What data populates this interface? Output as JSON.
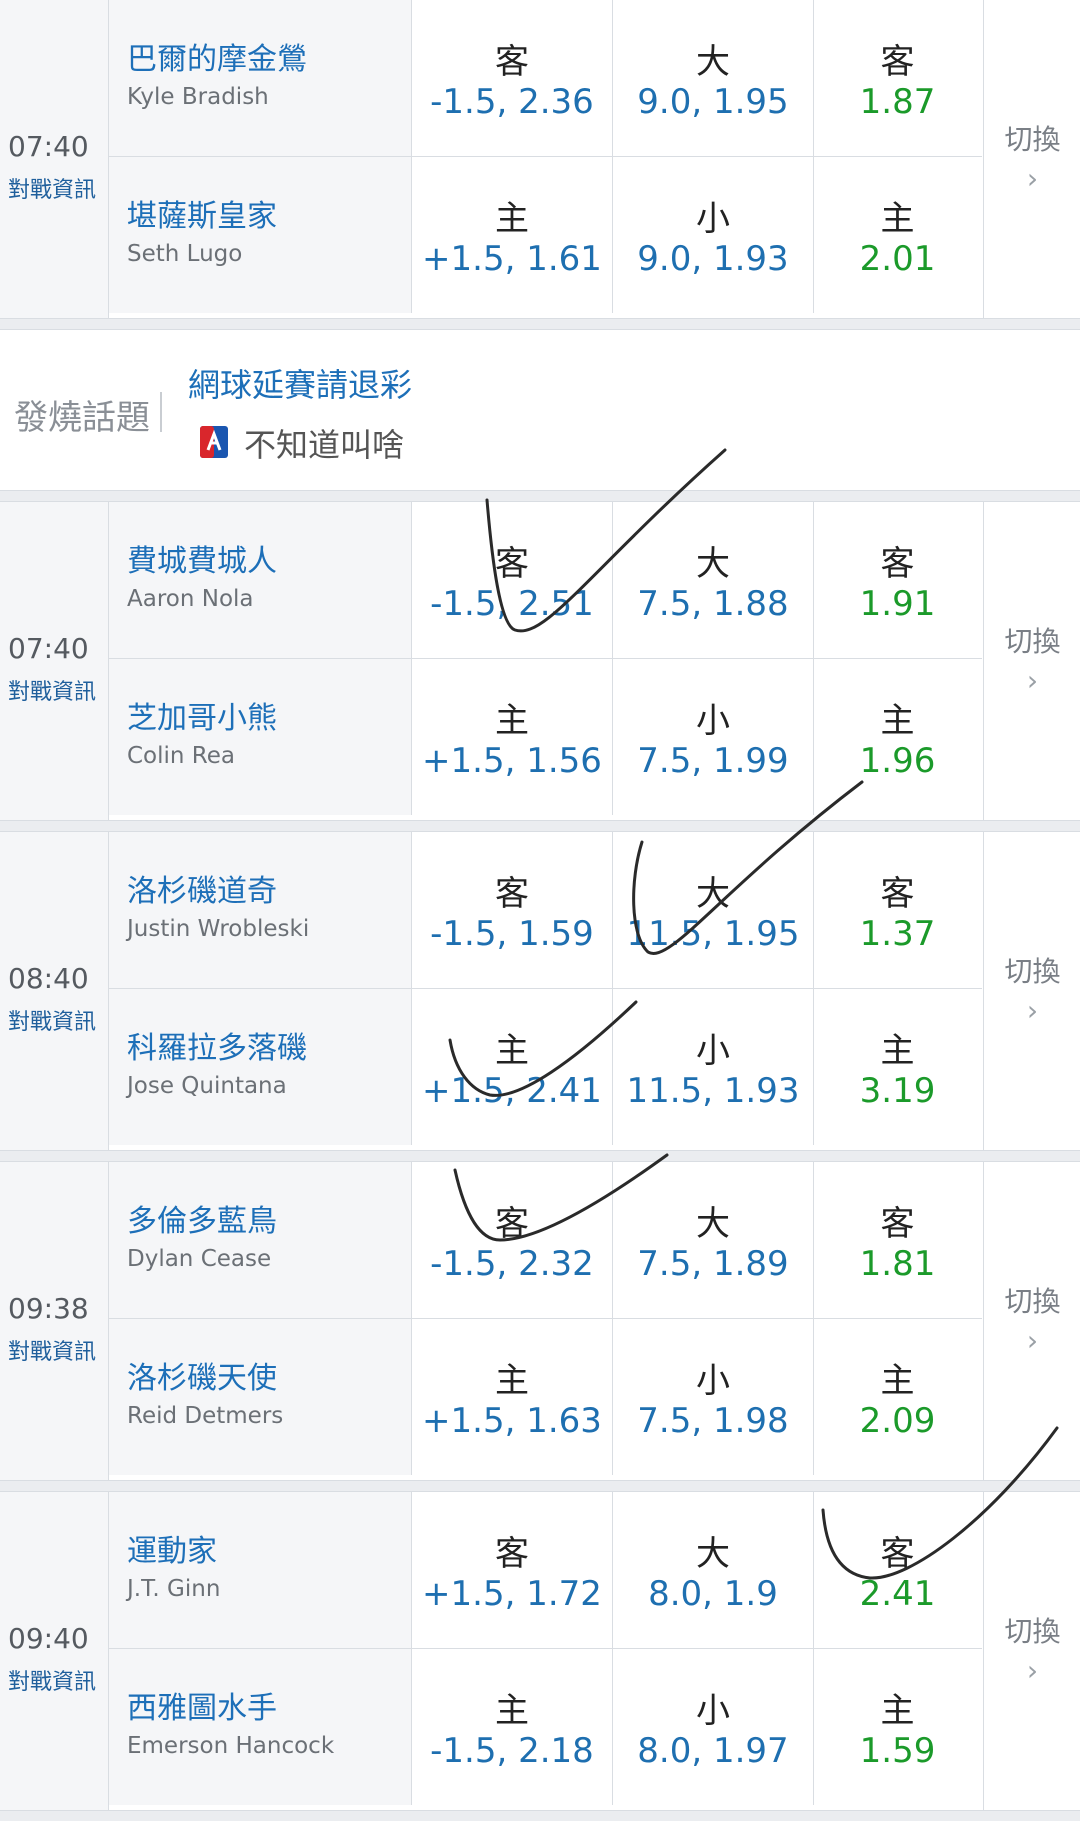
{
  "switch_label": "切換",
  "info_label": "對戰資訊",
  "games_top": [
    {
      "time": "07:40",
      "rows": [
        {
          "cn": "巴爾的摩金鶯",
          "en": "Kyle Bradish",
          "l1": "客",
          "v1": "-1.5, 2.36",
          "l2": "大",
          "v2": "9.0, 1.95",
          "l3": "客",
          "v3": "1.87"
        },
        {
          "cn": "堪薩斯皇家",
          "en": "Seth Lugo",
          "l1": "主",
          "v1": "+1.5, 1.61",
          "l2": "小",
          "v2": "9.0, 1.93",
          "l3": "主",
          "v3": "2.01"
        }
      ]
    }
  ],
  "hot_topic": {
    "label": "發燒話題",
    "title": "網球延賽請退彩",
    "author": "不知道叫啥"
  },
  "games": [
    {
      "time": "07:40",
      "rows": [
        {
          "cn": "費城費城人",
          "en": "Aaron Nola",
          "l1": "客",
          "v1": "-1.5, 2.51",
          "l2": "大",
          "v2": "7.5, 1.88",
          "l3": "客",
          "v3": "1.91"
        },
        {
          "cn": "芝加哥小熊",
          "en": "Colin Rea",
          "l1": "主",
          "v1": "+1.5, 1.56",
          "l2": "小",
          "v2": "7.5, 1.99",
          "l3": "主",
          "v3": "1.96"
        }
      ]
    },
    {
      "time": "08:40",
      "rows": [
        {
          "cn": "洛杉磯道奇",
          "en": "Justin Wrobleski",
          "l1": "客",
          "v1": "-1.5, 1.59",
          "l2": "大",
          "v2": "11.5, 1.95",
          "l3": "客",
          "v3": "1.37"
        },
        {
          "cn": "科羅拉多落磯",
          "en": "Jose Quintana",
          "l1": "主",
          "v1": "+1.5, 2.41",
          "l2": "小",
          "v2": "11.5, 1.93",
          "l3": "主",
          "v3": "3.19"
        }
      ]
    },
    {
      "time": "09:38",
      "rows": [
        {
          "cn": "多倫多藍鳥",
          "en": "Dylan Cease",
          "l1": "客",
          "v1": "-1.5, 2.32",
          "l2": "大",
          "v2": "7.5, 1.89",
          "l3": "客",
          "v3": "1.81"
        },
        {
          "cn": "洛杉磯天使",
          "en": "Reid Detmers",
          "l1": "主",
          "v1": "+1.5, 1.63",
          "l2": "小",
          "v2": "7.5, 1.98",
          "l3": "主",
          "v3": "2.09"
        }
      ]
    },
    {
      "time": "09:40",
      "rows": [
        {
          "cn": "運動家",
          "en": "J.T. Ginn",
          "l1": "客",
          "v1": "+1.5, 1.72",
          "l2": "大",
          "v2": "8.0, 1.9",
          "l3": "客",
          "v3": "2.41"
        },
        {
          "cn": "西雅圖水手",
          "en": "Emerson Hancock",
          "l1": "主",
          "v1": "-1.5, 2.18",
          "l2": "小",
          "v2": "8.0, 1.97",
          "l3": "主",
          "v3": "1.59"
        }
      ]
    }
  ],
  "colors": {
    "handicap": "#1e6fb0",
    "total": "#1e6fb0",
    "moneyline": "#1b9a2a",
    "team": "#1d6fb8"
  }
}
